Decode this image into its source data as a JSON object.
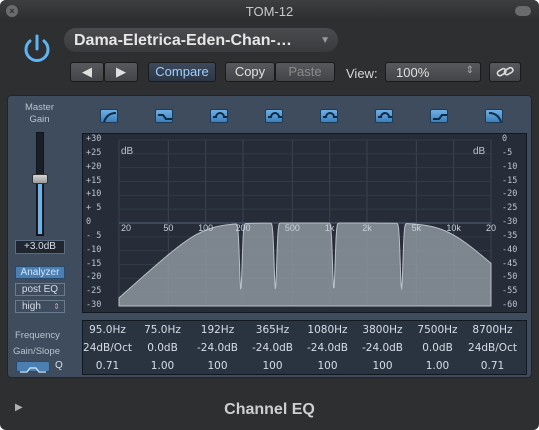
{
  "window": {
    "title": "TOM-12"
  },
  "header": {
    "preset_name": "Dama-Eletrica-Eden-Chan-…",
    "compare_label": "Compare",
    "copy_label": "Copy",
    "paste_label": "Paste",
    "view_label": "View:",
    "view_value": "100%"
  },
  "left": {
    "master_gain_label_1": "Master",
    "master_gain_label_2": "Gain",
    "gain_value": "+3.0dB",
    "master_gain_db": 3.0,
    "analyzer_label": "Analyzer",
    "analyzer_mode": "post EQ",
    "resolution": "high"
  },
  "graph": {
    "db_left": "dB",
    "db_right": "dB",
    "left_scale": [
      "+30",
      "+25",
      "+20",
      "+15",
      "+10",
      "+ 5",
      "0",
      "- 5",
      "-10",
      "-15",
      "-20",
      "-25",
      "-30"
    ],
    "right_scale": [
      "0",
      "-5",
      "-10",
      "-15",
      "-20",
      "-25",
      "-30",
      "-35",
      "-40",
      "-45",
      "-50",
      "-55",
      "-60"
    ],
    "freq_labels": [
      "20",
      "50",
      "100",
      "200",
      "500",
      "1k",
      "2k",
      "5k",
      "10k",
      "20"
    ]
  },
  "bands": {
    "row_labels": {
      "frequency": "Frequency",
      "gain_slope": "Gain/Slope",
      "q": "Q"
    },
    "frequency": [
      "95.0Hz",
      "75.0Hz",
      "192Hz",
      "365Hz",
      "1080Hz",
      "3800Hz",
      "7500Hz",
      "8700Hz"
    ],
    "gain_slope": [
      "24dB/Oct",
      "0.0dB",
      "-24.0dB",
      "-24.0dB",
      "-24.0dB",
      "-24.0dB",
      "0.0dB",
      "24dB/Oct"
    ],
    "q": [
      "0.71",
      "1.00",
      "100",
      "100",
      "100",
      "100",
      "1.00",
      "0.71"
    ],
    "types": [
      "lowcut-icon",
      "lowshelf-icon",
      "bell-icon",
      "bell-icon",
      "bell-icon",
      "bell-icon",
      "highshelf-icon",
      "highcut-icon"
    ]
  },
  "footer": {
    "plugin_name": "Channel EQ"
  }
}
